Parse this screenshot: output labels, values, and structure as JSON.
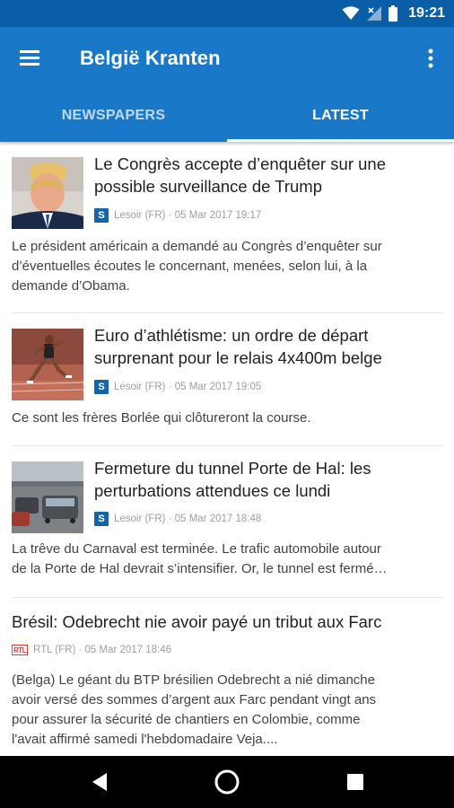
{
  "status_bar": {
    "time": "19:21",
    "icons": [
      "wifi-icon",
      "signal-icon",
      "battery-icon"
    ]
  },
  "app_bar": {
    "title": "België Kranten",
    "menu_icon": "hamburger-icon",
    "overflow_icon": "more-vert-icon"
  },
  "tabs": [
    {
      "label": "NEWSPAPERS",
      "selected": false
    },
    {
      "label": "LATEST",
      "selected": true
    }
  ],
  "articles": [
    {
      "title_line1": "Le Congrès accepte d’enquêter sur une",
      "title_line2": "possible surveillance de Trump",
      "meta": "Lesoir (FR) · 05 Mar 2017 19:17",
      "source_logo": "S",
      "summary_line1": "Le président américain a demandé au Congrès d’enquêter sur",
      "summary_line2": "d’éventuelles écoutes le concernant, menées, selon lui, à la",
      "summary_line3": "demande d’Obama."
    },
    {
      "title_line1": "Euro d’athlétisme: un ordre de départ",
      "title_line2": "surprenant pour le relais 4x400m belge",
      "meta": "Lesoir (FR) · 05 Mar 2017 19:05",
      "source_logo": "S",
      "summary_line1": "Ce sont les frères Borlée qui clôtureront la course."
    },
    {
      "title_line1": "Fermeture du tunnel Porte de Hal: les",
      "title_line2": "perturbations attendues ce lundi",
      "meta": "Lesoir (FR) · 05 Mar 2017 18:48",
      "source_logo": "S",
      "summary_line1": "La trêve du Carnaval est terminée. Le trafic automobile autour",
      "summary_line2": "de la Porte de Hal devrait s’intensifier. Or, le tunnel est fermé…"
    },
    {
      "title_line1": "Brésil: Odebrecht nie avoir payé un tribut aux Farc",
      "meta": "RTL (FR) · 05 Mar 2017 18:46",
      "source_logo": "RTL",
      "summary_line1": "(Belga) Le géant du BTP brésilien Odebrecht a nié dimanche",
      "summary_line2": "avoir versé des sommes d’argent aux Farc pendant vingt ans",
      "summary_line3": "pour assurer la sécurité de chantiers en Colombie, comme",
      "summary_line4": "l'avait affirmé samedi l'hebdomadaire Veja...."
    }
  ],
  "nav_bar": {
    "back_icon": "back-triangle-icon",
    "home_icon": "home-circle-icon",
    "recents_icon": "recents-square-icon"
  },
  "colors": {
    "primary": "#1a78c9",
    "primary_dark": "#0a5ea8",
    "source_logo": "#1565a8",
    "rtl_red": "#e53935"
  }
}
